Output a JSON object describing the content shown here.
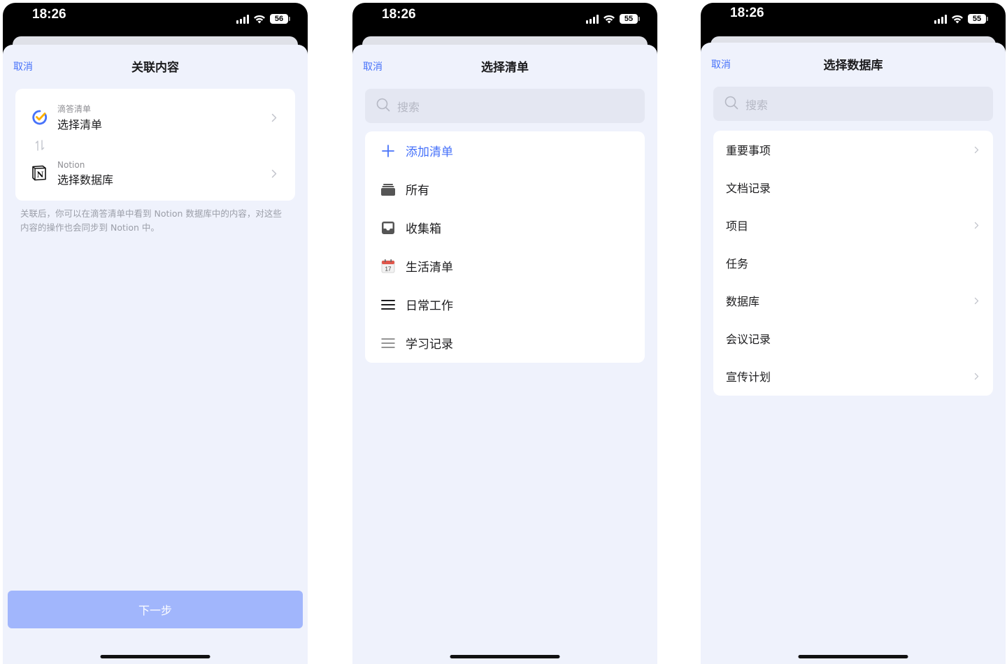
{
  "screens": [
    {
      "status": {
        "time": "18:26",
        "battery": "56"
      },
      "nav": {
        "cancel": "取消",
        "title": "关联内容"
      },
      "source": {
        "app_name": "滴答清单",
        "action": "选择清单"
      },
      "target": {
        "app_name": "Notion",
        "action": "选择数据库"
      },
      "hint": "关联后，你可以在滴答清单中看到 Notion 数据库中的内容，对这些内容的操作也会同步到 Notion 中。",
      "next_button": "下一步"
    },
    {
      "status": {
        "time": "18:26",
        "battery": "55"
      },
      "nav": {
        "cancel": "取消",
        "title": "选择清单"
      },
      "search_placeholder": "搜索",
      "add_list": "添加清单",
      "lists": [
        {
          "label": "所有",
          "icon": "tray-stack-icon"
        },
        {
          "label": "收集箱",
          "icon": "inbox-icon"
        },
        {
          "label": "生活清单",
          "icon": "calendar-emoji-icon",
          "icon_text": "17"
        },
        {
          "label": "日常工作",
          "icon": "hamburger-list-icon"
        },
        {
          "label": "学习记录",
          "icon": "thin-list-icon"
        }
      ]
    },
    {
      "status": {
        "time": "18:26",
        "battery": "55"
      },
      "nav": {
        "cancel": "取消",
        "title": "选择数据库"
      },
      "search_placeholder": "搜索",
      "databases": [
        {
          "label": "重要事项",
          "has_children": true
        },
        {
          "label": "文档记录",
          "has_children": false
        },
        {
          "label": "项目",
          "has_children": true
        },
        {
          "label": "任务",
          "has_children": false
        },
        {
          "label": "数据库",
          "has_children": true
        },
        {
          "label": "会议记录",
          "has_children": false
        },
        {
          "label": "宣传计划",
          "has_children": true
        }
      ]
    }
  ],
  "colors": {
    "accent": "#4772fa",
    "sheet_bg": "#eff2fc",
    "disabled_button": "#a1b6fc"
  }
}
